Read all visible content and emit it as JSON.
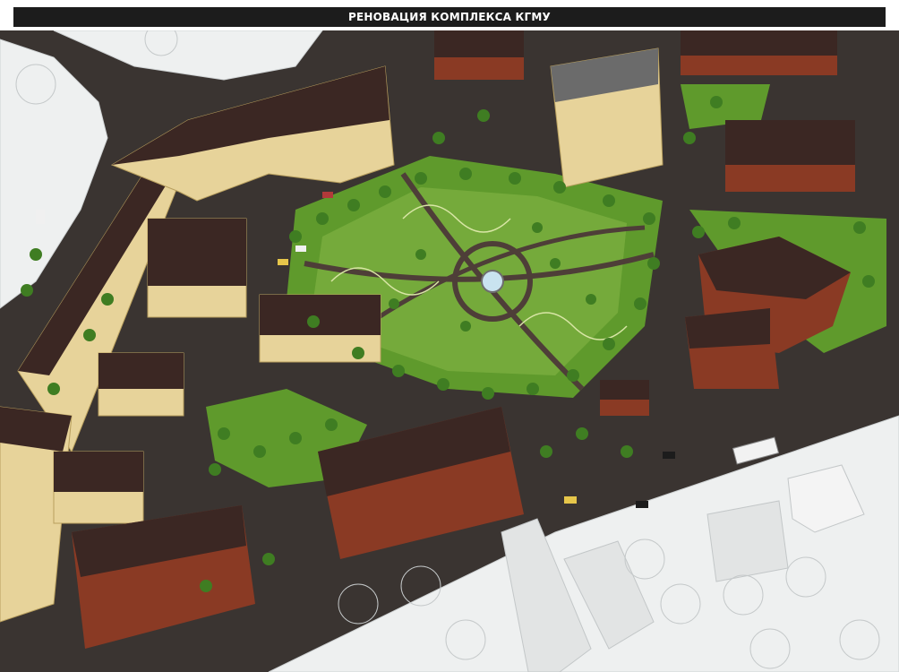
{
  "header": {
    "title": "РЕНОВАЦИЯ КОМПЛЕКСА КГМУ"
  },
  "image": {
    "kind": "aerial architectural rendering",
    "palette": {
      "road": "#3a3431",
      "plaza": "#5b4a44",
      "lawn": "#5f9a2c",
      "lawn_light": "#86b848",
      "tree": "#3f7d22",
      "brick": "#8a3a24",
      "roof": "#3b2723",
      "beige": "#e7d39a",
      "white_block": "#eef0f0",
      "water": "#c9e3f0"
    }
  }
}
